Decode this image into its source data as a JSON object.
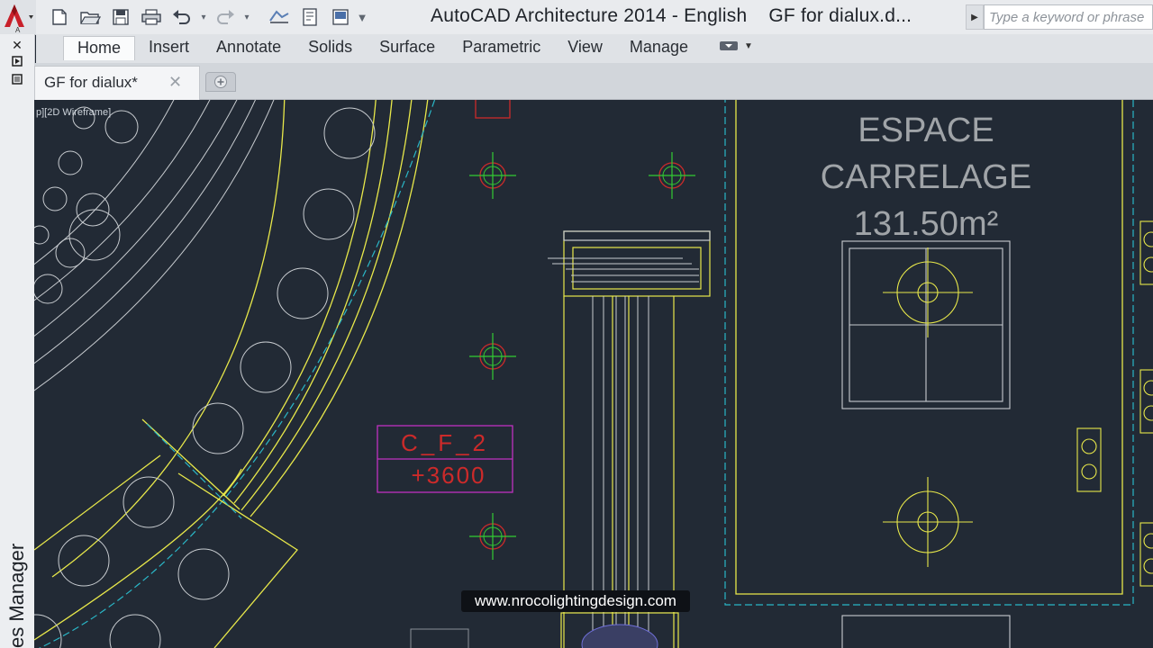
{
  "app": {
    "title": "AutoCAD Architecture 2014 - English",
    "document_title": "GF for dialux.d...",
    "search_placeholder": "Type a keyword or phrase"
  },
  "ribbon": {
    "tabs": [
      "Home",
      "Insert",
      "Annotate",
      "Solids",
      "Surface",
      "Parametric",
      "View",
      "Manage"
    ],
    "active_tab": "Home"
  },
  "quick_access": {
    "icons": [
      "new-file-icon",
      "open-folder-icon",
      "save-icon",
      "print-icon",
      "undo-icon",
      "redo-icon",
      "workspace-icon",
      "sheet-icon",
      "layer-icon",
      "dropdown-icon"
    ]
  },
  "left_panel": {
    "title": "es Manager"
  },
  "document_tabs": [
    {
      "label": "GF for dialux*",
      "active": true
    }
  ],
  "viewport": {
    "label": "p][2D Wireframe]"
  },
  "drawing": {
    "room_name_line1": "ESPACE",
    "room_name_line2": "CARRELAGE",
    "room_area": "131.50m²",
    "tag_code": "C_F_2",
    "tag_level": "+3600",
    "colors": {
      "background": "#222a35",
      "yellow": "#e8e84a",
      "green": "#33cc33",
      "red": "#cc2a2a",
      "cyan": "#2ab7c7",
      "magenta": "#c030c0",
      "white": "#d0d4d8",
      "gray_text": "#a0a4a8"
    }
  },
  "watermark": {
    "text": "www.nrocolightingdesign.com"
  }
}
